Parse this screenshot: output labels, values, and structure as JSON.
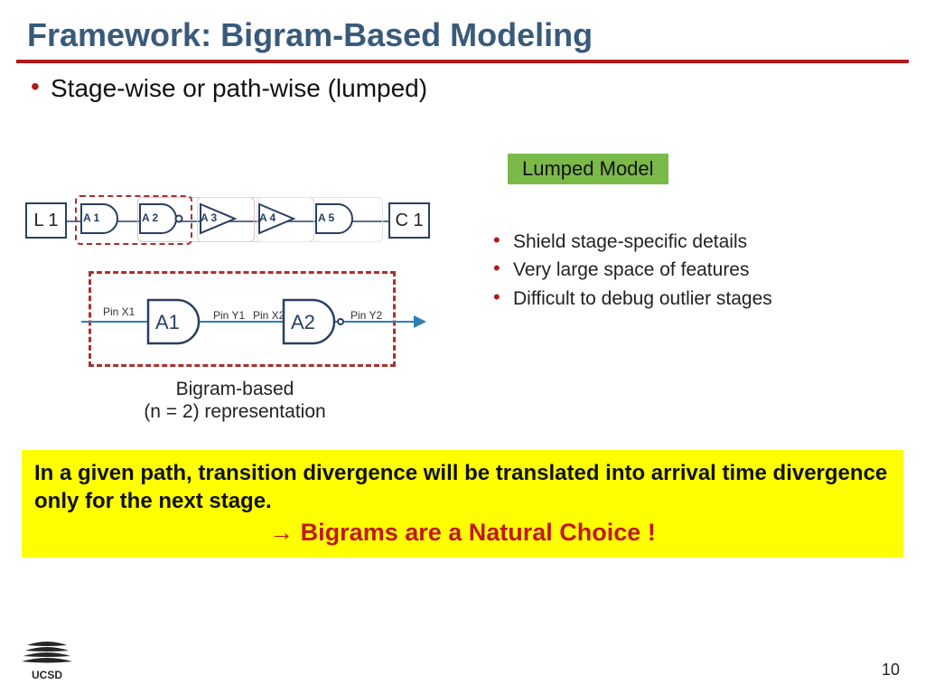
{
  "title": "Framework:  Bigram-Based Modeling",
  "main_bullet": "Stage-wise or path-wise (lumped)",
  "lumped_badge": "Lumped Model",
  "sub_bullets": [
    "Shield stage-specific details",
    "Very large space of features",
    "Difficult to debug outlier stages"
  ],
  "diagram1": {
    "left": "L 1",
    "right": "C 1",
    "gates": [
      "A 1",
      "A 2",
      "A 3",
      "A 4",
      "A 5"
    ]
  },
  "diagram2": {
    "pin_x1": "Pin X1",
    "pin_y1": "Pin Y1",
    "pin_x2": "Pin X2",
    "pin_y2": "Pin Y2",
    "g1": "A1",
    "g2": "A2"
  },
  "d2_caption_l1": "Bigram-based",
  "d2_caption_l2": "(n = 2) representation",
  "highlight": {
    "line1": "In a given path, transition divergence will be translated into arrival time divergence only for the next stage.",
    "line2_arrow": "→",
    "line2": " Bigrams are a Natural Choice !"
  },
  "footer": {
    "org": "UCSD",
    "page": "10"
  }
}
